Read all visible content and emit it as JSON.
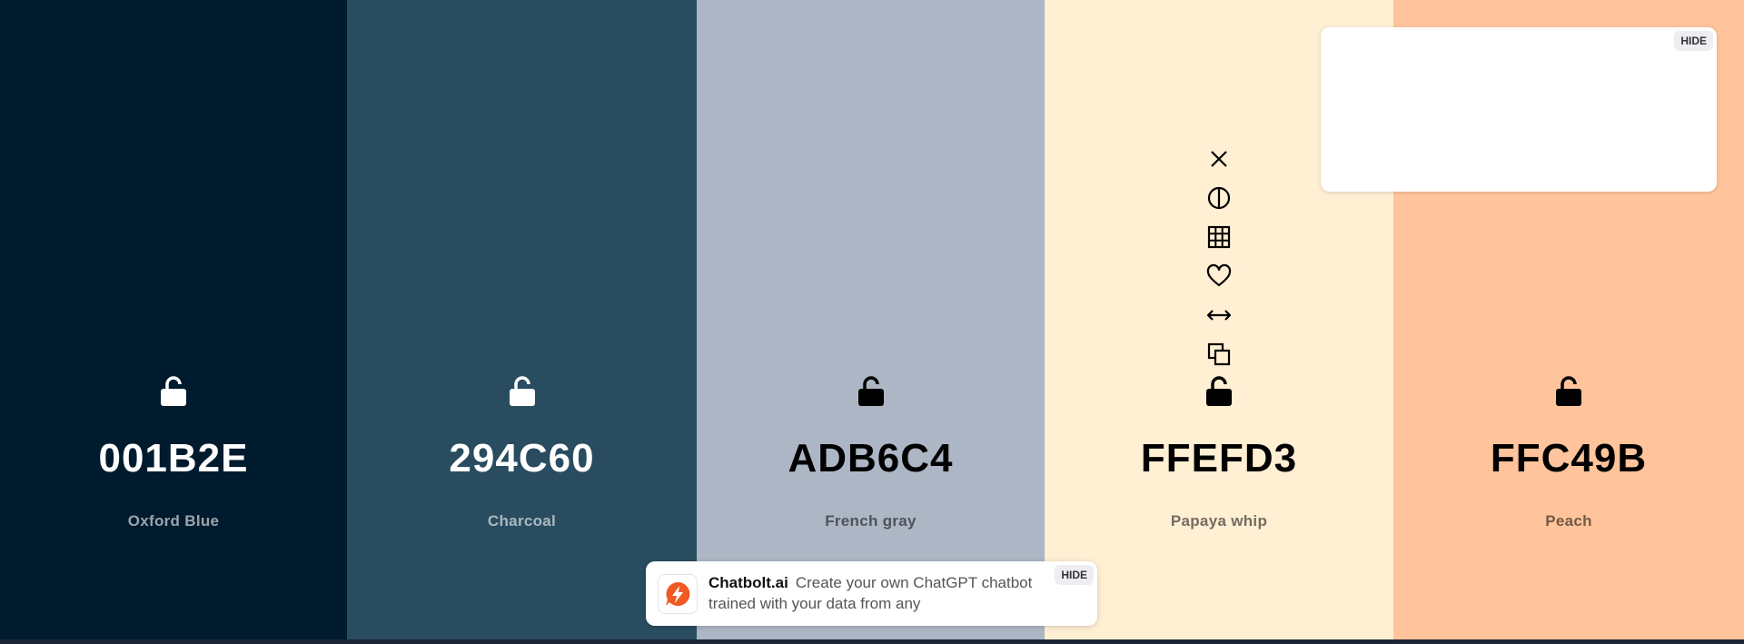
{
  "palette": [
    {
      "hex": "001B2E",
      "name": "Oxford Blue",
      "bg": "#001b2e",
      "text": "#ffffff",
      "sub": "rgba(255,255,255,0.6)",
      "locked": false
    },
    {
      "hex": "294C60",
      "name": "Charcoal",
      "bg": "#294c60",
      "text": "#ffffff",
      "sub": "rgba(255,255,255,0.6)",
      "locked": false
    },
    {
      "hex": "ADB6C4",
      "name": "French gray",
      "bg": "#adb6c4",
      "text": "#000000",
      "sub": "rgba(0,0,0,0.55)",
      "locked": true
    },
    {
      "hex": "FFEFD3",
      "name": "Papaya whip",
      "bg": "#ffefd3",
      "text": "#000000",
      "sub": "rgba(0,0,0,0.55)",
      "locked": true
    },
    {
      "hex": "FFC49B",
      "name": "Peach",
      "bg": "#ffc49b",
      "text": "#000000",
      "sub": "rgba(0,0,0,0.55)",
      "locked": true
    }
  ],
  "tools": [
    "close-icon",
    "contrast-icon",
    "shades-grid-icon",
    "heart-icon",
    "drag-arrows-icon",
    "copy-icon"
  ],
  "ad": {
    "hide_label": "HIDE"
  },
  "banner": {
    "brand": "Chatbolt.ai",
    "text": "Create your own ChatGPT chatbot trained with your data from any",
    "hide_label": "HIDE",
    "logo_color": "#f05a22"
  }
}
